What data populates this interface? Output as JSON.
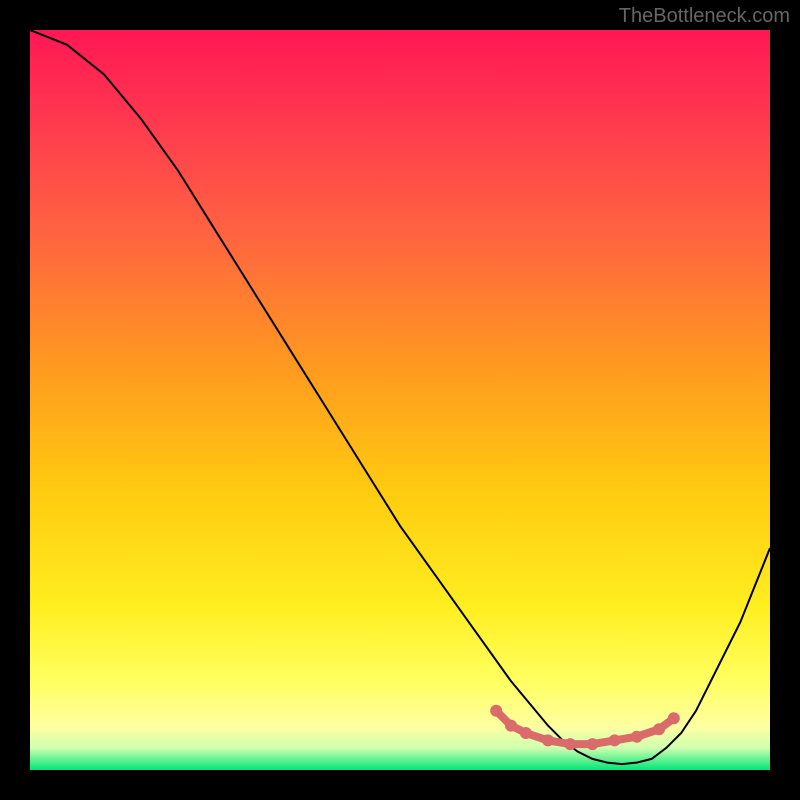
{
  "watermark": "TheBottleneck.com",
  "chart_data": {
    "type": "line",
    "title": "",
    "xlabel": "",
    "ylabel": "",
    "x": [
      0,
      5,
      10,
      15,
      20,
      25,
      30,
      35,
      40,
      45,
      50,
      55,
      60,
      65,
      70,
      72,
      74,
      76,
      78,
      80,
      82,
      84,
      86,
      88,
      90,
      92,
      94,
      96,
      98,
      100
    ],
    "values": [
      100,
      98,
      94,
      88,
      81,
      73,
      65,
      57,
      49,
      41,
      33,
      26,
      19,
      12,
      6,
      4,
      2.5,
      1.5,
      1,
      0.8,
      1,
      1.5,
      3,
      5,
      8,
      12,
      16,
      20,
      25,
      30
    ],
    "ylim": [
      0,
      100
    ],
    "xlim": [
      0,
      100
    ],
    "gradient_colors": {
      "top": "#ff1744",
      "middle_top": "#ff5252",
      "middle": "#ff9100",
      "middle_bottom": "#ffea00",
      "bottom_yellow": "#ffff8d",
      "bottom": "#00e676"
    },
    "marker_points": {
      "x": [
        63,
        65,
        67,
        70,
        73,
        76,
        79,
        82,
        85,
        87
      ],
      "y": [
        8,
        6,
        5,
        4,
        3.5,
        3.5,
        4,
        4.5,
        5.5,
        7
      ],
      "color": "#d96b6b"
    }
  }
}
